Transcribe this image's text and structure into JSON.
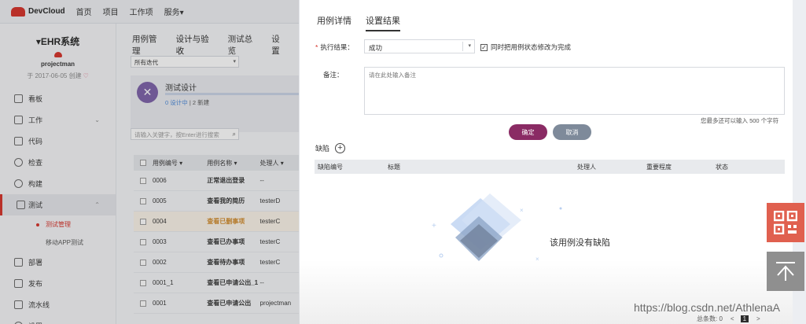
{
  "topnav": {
    "logo": "DevCloud",
    "items": [
      "首页",
      "项目",
      "工作项",
      "服务▾"
    ]
  },
  "sidebar": {
    "project_title": "▾EHR系统",
    "owner": "projectman",
    "created": "于 2017-06-05 创建",
    "items": [
      {
        "label": "看板",
        "icon": "dashboard-icon"
      },
      {
        "label": "工作",
        "icon": "document-icon",
        "expandable": true
      },
      {
        "label": "代码",
        "icon": "code-icon"
      },
      {
        "label": "检查",
        "icon": "check-icon"
      },
      {
        "label": "构建",
        "icon": "gear-icon"
      },
      {
        "label": "测试",
        "icon": "test-icon",
        "expandable": true,
        "active": true
      },
      {
        "label": "部署",
        "icon": "cube-icon"
      },
      {
        "label": "发布",
        "icon": "release-icon"
      },
      {
        "label": "流水线",
        "icon": "pipeline-icon"
      },
      {
        "label": "设置",
        "icon": "settings-icon"
      }
    ],
    "sub_items": [
      "测试管理",
      "移动APP测试"
    ]
  },
  "main": {
    "tabs": [
      "用例管理",
      "设计与验收",
      "测试总览",
      "设置"
    ],
    "iteration_select": "所有迭代",
    "design_card": {
      "title": "测试设计",
      "designing": "0 设计中",
      "new": "2 新建"
    },
    "search_placeholder": "请输入关键字，按Enter进行搜索",
    "table": {
      "headers": [
        "用例编号 ▾",
        "用例名称 ▾",
        "处理人 ▾"
      ],
      "rows": [
        [
          "0006",
          "正常退出登录",
          "--"
        ],
        [
          "0005",
          "查看我的简历",
          "testerD"
        ],
        [
          "0004",
          "查看已删事项",
          "testerC"
        ],
        [
          "0003",
          "查看已办事项",
          "testerC"
        ],
        [
          "0002",
          "查看待办事项",
          "testerC"
        ],
        [
          "0001_1",
          "查看已申请公出_1",
          "--"
        ],
        [
          "0001",
          "查看已申请公出",
          "projectman"
        ]
      ]
    }
  },
  "panel": {
    "tabs": [
      "用例详情",
      "设置结果"
    ],
    "result_label": "执行结果：",
    "result_value": "成功",
    "sync_label": "同时把用例状态修改为完成",
    "remark_label": "备注：",
    "remark_placeholder": "请在此处输入备注",
    "char_hint": "您最多还可以输入 500 个字符",
    "ok_label": "确定",
    "cancel_label": "取消",
    "defect_label": "缺陷",
    "defect_headers": [
      "缺陷编号",
      "标题",
      "处理人",
      "重要程度",
      "状态"
    ],
    "empty_text": "该用例没有缺陷",
    "pager": {
      "total": "总条数: 0",
      "prev": "<",
      "page": "1",
      "next": ">"
    }
  },
  "watermark": "https://blog.csdn.net/AthlenaA",
  "colors": {
    "brand_red": "#d52e25",
    "ok_button": "#8a2b64",
    "cancel_button": "#7e8a9a",
    "qr_button": "#e0604f"
  }
}
